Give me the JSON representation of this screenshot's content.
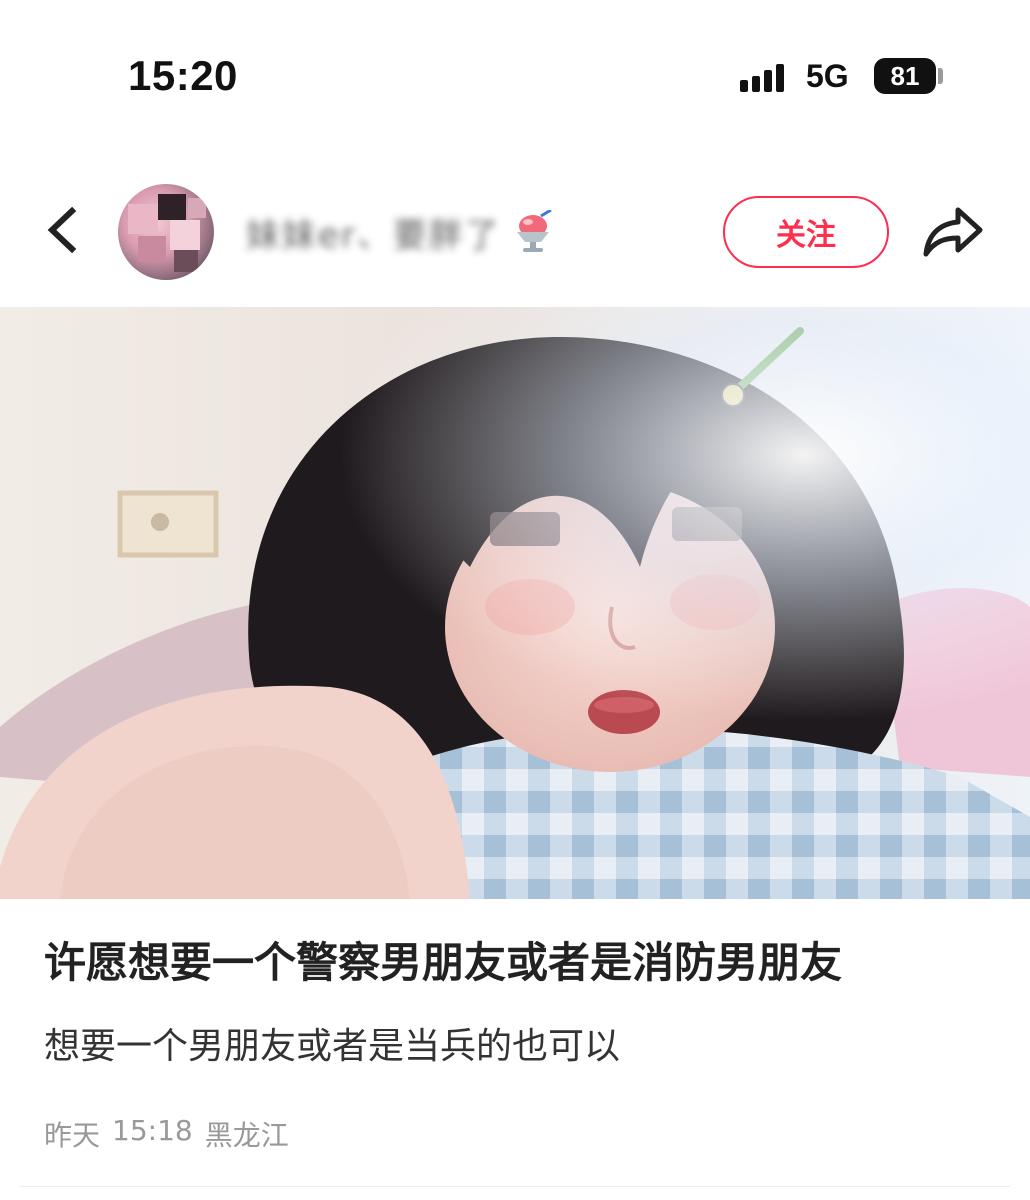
{
  "status_bar": {
    "time": "15:20",
    "network": "5G",
    "battery": "81"
  },
  "header": {
    "back_icon": "chevron-left-icon",
    "username": "妹妹er、要胖了",
    "username_emoji": "shaved-ice-emoji",
    "follow_label": "关注",
    "share_icon": "share-arrow-icon",
    "accent_color": "#ff2e4d"
  },
  "post": {
    "title": "许愿想要一个警察男朋友或者是消防男朋友",
    "body": "想要一个男朋友或者是当兵的也可以",
    "meta": {
      "date": "昨天",
      "time": "15:18",
      "location": "黑龙江"
    }
  }
}
